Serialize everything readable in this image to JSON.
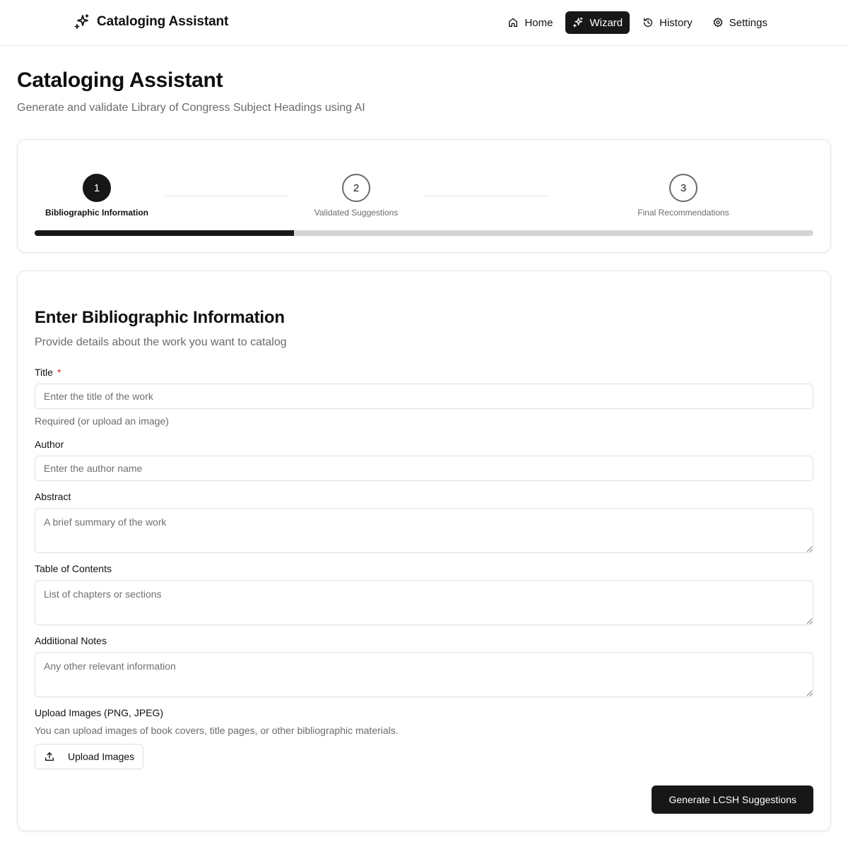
{
  "app": {
    "title": "Cataloging Assistant",
    "icon": "sparkles-icon"
  },
  "nav": {
    "items": [
      {
        "label": "Home",
        "icon": "home-icon",
        "active": false
      },
      {
        "label": "Wizard",
        "icon": "sparkles-icon",
        "active": true
      },
      {
        "label": "History",
        "icon": "history-icon",
        "active": false
      },
      {
        "label": "Settings",
        "icon": "gear-icon",
        "active": false
      }
    ]
  },
  "header": {
    "title": "Cataloging Assistant",
    "subtitle": "Generate and validate Library of Congress Subject Headings using AI"
  },
  "stepper": {
    "current_step": 1,
    "progress": 0.333,
    "steps": [
      {
        "number": "1",
        "label": "Bibliographic Information"
      },
      {
        "number": "2",
        "label": "Validated Suggestions"
      },
      {
        "number": "3",
        "label": "Final Recommendations"
      }
    ]
  },
  "form": {
    "title": "Enter Bibliographic Information",
    "description": "Provide details about the work you want to catalog",
    "fields": {
      "title": {
        "label": "Title",
        "required_mark": "*",
        "placeholder": "Enter the title of the work",
        "value": "",
        "helper": "Required (or upload an image)"
      },
      "author": {
        "label": "Author",
        "placeholder": "Enter the author name",
        "value": ""
      },
      "abstract": {
        "label": "Abstract",
        "placeholder": "A brief summary of the work",
        "value": ""
      },
      "toc": {
        "label": "Table of Contents",
        "placeholder": "List of chapters or sections",
        "value": ""
      },
      "notes": {
        "label": "Additional Notes",
        "placeholder": "Any other relevant information",
        "value": ""
      }
    },
    "upload": {
      "label": "Upload Images (PNG, JPEG)",
      "helper": "You can upload images of book covers, title pages, or other bibliographic materials.",
      "button_label": "Upload Images",
      "icon": "upload-icon"
    },
    "submit_label": "Generate LCSH Suggestions"
  },
  "colors": {
    "primary": "#171717",
    "muted_text": "#6b6b6b",
    "border": "#e4e4e4",
    "required": "#c81e1e",
    "progress_track": "#d4d4d4"
  }
}
